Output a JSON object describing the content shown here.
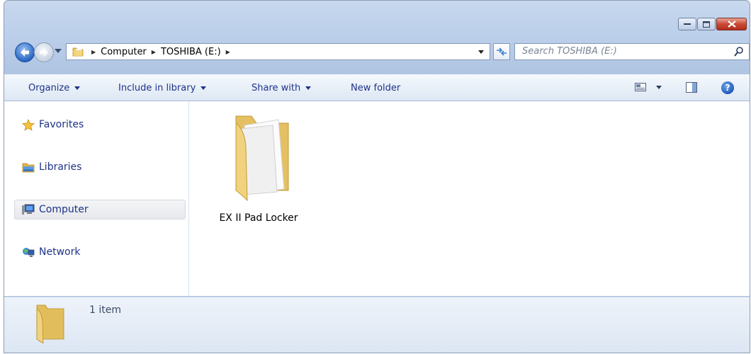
{
  "window": {
    "caption_buttons": [
      "minimize",
      "maximize",
      "close"
    ]
  },
  "address": {
    "crumbs": [
      "Computer",
      "TOSHIBA (E:)"
    ],
    "search_placeholder": "Search TOSHIBA (E:)"
  },
  "toolbar": {
    "organize": "Organize",
    "include_in_library": "Include in library",
    "share_with": "Share with",
    "new_folder": "New folder",
    "help": "?"
  },
  "nav": {
    "favorites": "Favorites",
    "libraries": "Libraries",
    "computer": "Computer",
    "network": "Network"
  },
  "content": {
    "items": [
      {
        "name": "EX II Pad Locker",
        "icon": "folder-icon"
      }
    ]
  },
  "details": {
    "count": "1 item"
  },
  "colors": {
    "link_text": "#1e3287",
    "frame": "#b9cde9",
    "close_button": "#c94a36"
  }
}
